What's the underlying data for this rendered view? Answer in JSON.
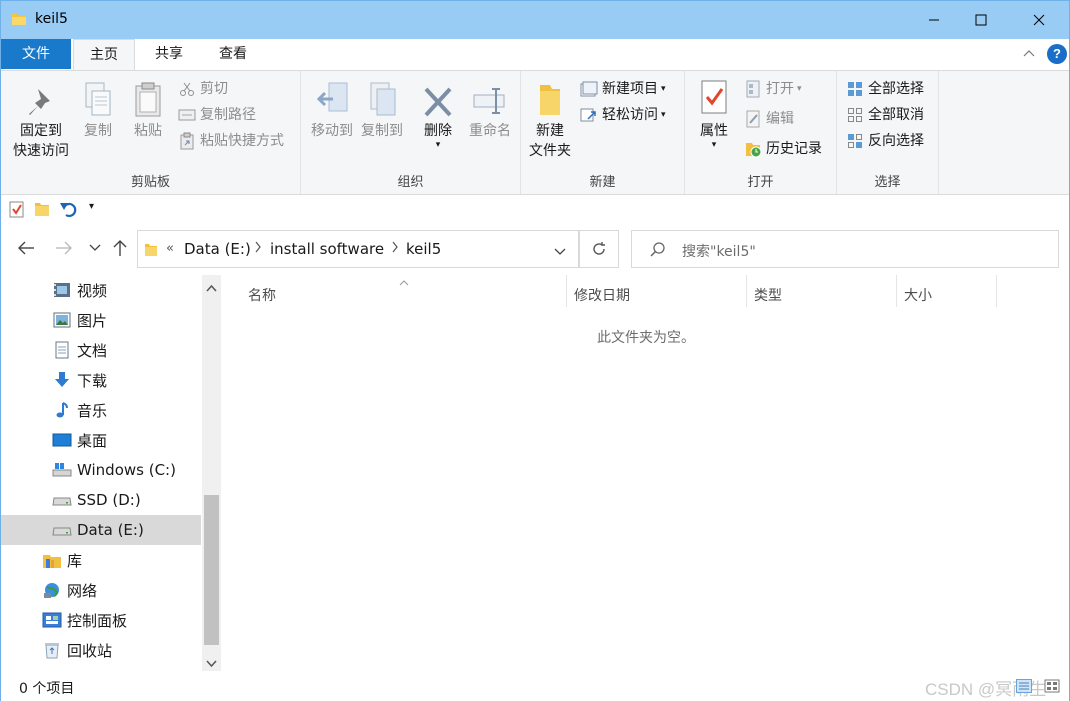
{
  "window": {
    "title": "keil5"
  },
  "ribbon_tabs": {
    "file": "文件",
    "home": "主页",
    "share": "共享",
    "view": "查看"
  },
  "help_label": "?",
  "clipboard": {
    "label": "剪贴板",
    "pin_line1": "固定到",
    "pin_line2": "快速访问",
    "copy": "复制",
    "paste": "粘贴",
    "cut": "剪切",
    "copy_path": "复制路径",
    "paste_shortcut": "粘贴快捷方式"
  },
  "organize": {
    "label": "组织",
    "move_to": "移动到",
    "copy_to": "复制到",
    "delete": "删除",
    "rename": "重命名"
  },
  "new": {
    "label": "新建",
    "new_folder_line1": "新建",
    "new_folder_line2": "文件夹",
    "new_item": "新建项目",
    "easy_access": "轻松访问"
  },
  "open": {
    "label": "打开",
    "properties": "属性",
    "open": "打开",
    "edit": "编辑",
    "history": "历史记录"
  },
  "select": {
    "label": "选择",
    "select_all": "全部选择",
    "select_none": "全部取消",
    "invert": "反向选择"
  },
  "address": {
    "overflow": "«",
    "crumbs": [
      "Data (E:)",
      "install software",
      "keil5"
    ]
  },
  "search": {
    "placeholder": "搜索\"keil5\""
  },
  "nav_items": [
    "视频",
    "图片",
    "文档",
    "下载",
    "音乐",
    "桌面",
    "Windows (C:)",
    "SSD (D:)",
    "Data (E:)",
    "库",
    "网络",
    "控制面板",
    "回收站"
  ],
  "columns": {
    "name": "名称",
    "modified": "修改日期",
    "type": "类型",
    "size": "大小"
  },
  "empty_message": "此文件夹为空。",
  "status": {
    "count": "0 个项目"
  },
  "watermark": "CSDN @冥雨生",
  "colors": {
    "titlebar": "#99ccf5",
    "file_tab": "#1979ca",
    "ribbon_bg": "#f5f6f7",
    "selected": "#d9d9d9"
  }
}
